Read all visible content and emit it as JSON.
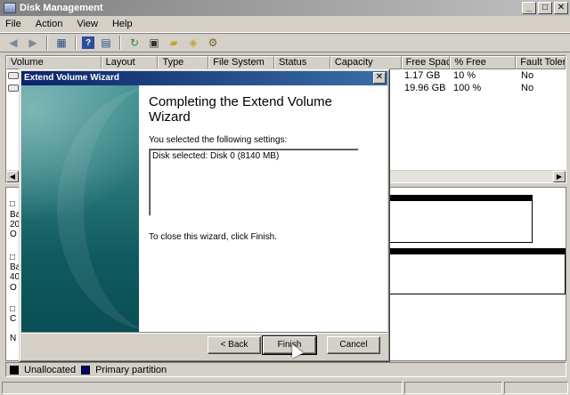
{
  "window": {
    "title": "Disk Management"
  },
  "menu": [
    "File",
    "Action",
    "View",
    "Help"
  ],
  "toolbar": {
    "icons": [
      "back-icon",
      "forward-icon",
      "show-hide-icon",
      "help-icon",
      "properties-icon",
      "refresh-icon",
      "rescan-icon",
      "open-icon",
      "explore-icon",
      "settings-icon"
    ]
  },
  "volumes": {
    "columns": [
      "Volume",
      "Layout",
      "Type",
      "File System",
      "Status",
      "Capacity",
      "Free Space",
      "% Free",
      "Fault Toleran"
    ],
    "rows": [
      {
        "free": "1.17 GB",
        "percent": "10 %",
        "fault": "No"
      },
      {
        "free": "19.96 GB",
        "percent": "100 %",
        "fault": "No"
      }
    ]
  },
  "disks": {
    "labels": [
      "□",
      "Ba",
      "20",
      "O",
      "□",
      "Ba",
      "40",
      "O",
      "□",
      "C",
      "N"
    ]
  },
  "legend": {
    "unallocated": "Unallocated",
    "primary": "Primary partition"
  },
  "colors": {
    "unallocated": "#000000",
    "primary": "#00006e",
    "dialog_title": "#0a246a"
  },
  "dialog": {
    "title": "Extend Volume Wizard",
    "heading": "Completing the Extend Volume Wizard",
    "intro": "You selected the following settings:",
    "settings": "Disk selected: Disk 0 (8140 MB)",
    "footer": "To close this wizard, click Finish.",
    "back": "< Back",
    "finish": "Finish",
    "cancel": "Cancel",
    "close": "✕"
  }
}
